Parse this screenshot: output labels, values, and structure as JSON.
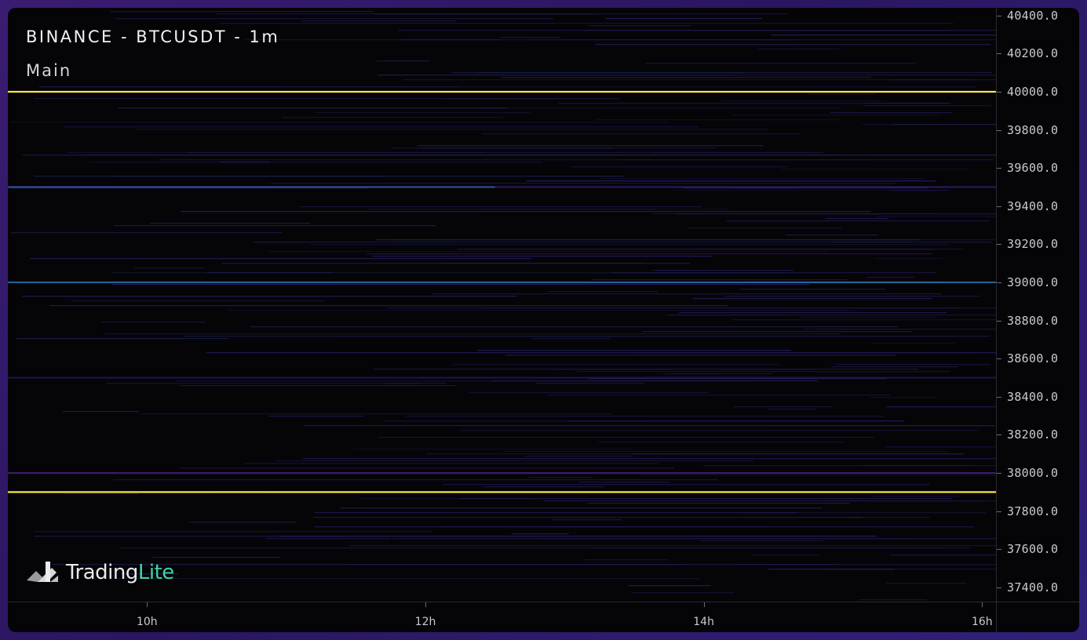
{
  "header": {
    "title": "BINANCE - BTCUSDT - 1m",
    "pane": "Main"
  },
  "logo": {
    "icon": "tradinglite-logo-icon",
    "text_a": "Trading",
    "text_b": "Lite",
    "accent_color": "#3fd3a4"
  },
  "colors": {
    "background": "#050407",
    "frame": "#3a1c72",
    "level_highlight": "#ffeb3b",
    "level_blue": "#3f6bd8",
    "level_purple": "#5a2fb0",
    "level_cyan": "#27b3a6"
  },
  "chart_data": {
    "type": "heatmap",
    "title": "BINANCE - BTCUSDT - 1m",
    "xlabel": "",
    "ylabel": "",
    "x_ticks": [
      "10h",
      "12h",
      "14h",
      "16h"
    ],
    "x_range_hours": [
      9.0,
      16.1
    ],
    "y_ticks": [
      37400.0,
      37600.0,
      37800.0,
      38000.0,
      38200.0,
      38400.0,
      38600.0,
      38800.0,
      39000.0,
      39200.0,
      39400.0,
      39600.0,
      39800.0,
      40000.0,
      40200.0,
      40400.0
    ],
    "y_tick_labels": [
      "37400.0",
      "37600.0",
      "37800.0",
      "38000.0",
      "38200.0",
      "38400.0",
      "38600.0",
      "38800.0",
      "39000.0",
      "39200.0",
      "39400.0",
      "39600.0",
      "39800.0",
      "40000.0",
      "40200.0",
      "40400.0"
    ],
    "ylim": [
      37325,
      40440
    ],
    "grid": false,
    "strong_levels": [
      {
        "price": 40000,
        "from_hour": 9.0,
        "to_hour": 16.1,
        "color": "#ffeb3b",
        "intensity": 1.0
      },
      {
        "price": 37900,
        "from_hour": 9.0,
        "to_hour": 16.1,
        "color": "#ffeb3b",
        "intensity": 1.0
      },
      {
        "price": 39000,
        "from_hour": 9.0,
        "to_hour": 16.1,
        "color": "#2f7fc0",
        "intensity": 0.75
      },
      {
        "price": 39500,
        "from_hour": 9.0,
        "to_hour": 12.5,
        "color": "#3f6bd8",
        "intensity": 0.7
      },
      {
        "price": 39500,
        "from_hour": 12.5,
        "to_hour": 16.1,
        "color": "#4b2ba0",
        "intensity": 0.55
      },
      {
        "price": 38000,
        "from_hour": 9.0,
        "to_hour": 16.1,
        "color": "#5a2fb0",
        "intensity": 0.6
      },
      {
        "price": 38500,
        "from_hour": 9.0,
        "to_hour": 16.1,
        "color": "#3d2390",
        "intensity": 0.45
      }
    ]
  }
}
